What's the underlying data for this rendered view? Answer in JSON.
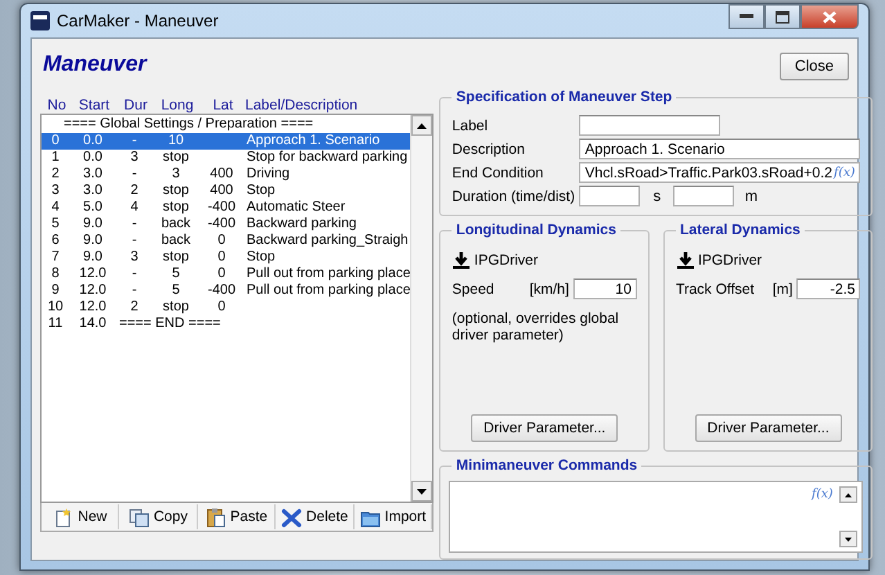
{
  "window": {
    "title": "CarMaker - Maneuver"
  },
  "heading": "Maneuver",
  "close_button": "Close",
  "list": {
    "columns": [
      "No",
      "Start",
      "Dur",
      "Long",
      "Lat",
      "Label/Description"
    ],
    "rows": [
      {
        "kind": "banner",
        "text": "==== Global Settings / Preparation ====",
        "selected": false
      },
      {
        "kind": "step",
        "no": "0",
        "start": "0.0",
        "dur": "-",
        "long": "10",
        "label": "Approach 1. Scenario",
        "selected": true
      },
      {
        "kind": "step",
        "no": "1",
        "start": "0.0",
        "dur": "3",
        "long": "stop",
        "label": "Stop for backward parking",
        "selected": false
      },
      {
        "kind": "step",
        "no": "2",
        "start": "3.0",
        "dur": "-",
        "long": "3",
        "lat": "400",
        "label": "Driving",
        "selected": false
      },
      {
        "kind": "step",
        "no": "3",
        "start": "3.0",
        "dur": "2",
        "long": "stop",
        "lat": "400",
        "label": "Stop",
        "selected": false
      },
      {
        "kind": "step",
        "no": "4",
        "start": "5.0",
        "dur": "4",
        "long": "stop",
        "lat": "-400",
        "label": "Automatic Steer",
        "selected": false
      },
      {
        "kind": "step",
        "no": "5",
        "start": "9.0",
        "dur": "-",
        "long": "back",
        "lat": "-400",
        "label": "Backward parking",
        "selected": false
      },
      {
        "kind": "step",
        "no": "6",
        "start": "9.0",
        "dur": "-",
        "long": "back",
        "lat": "0",
        "label": "Backward parking_Straigh",
        "selected": false
      },
      {
        "kind": "step",
        "no": "7",
        "start": "9.0",
        "dur": "3",
        "long": "stop",
        "lat": "0",
        "label": "Stop",
        "selected": false
      },
      {
        "kind": "step",
        "no": "8",
        "start": "12.0",
        "dur": "-",
        "long": "5",
        "lat": "0",
        "label": "Pull out from parking place",
        "selected": false
      },
      {
        "kind": "step",
        "no": "9",
        "start": "12.0",
        "dur": "-",
        "long": "5",
        "lat": "-400",
        "label": "Pull out from parking place",
        "selected": false
      },
      {
        "kind": "step",
        "no": "10",
        "start": "12.0",
        "dur": "2",
        "long": "stop",
        "lat": "0",
        "selected": false
      },
      {
        "kind": "end",
        "no": "11",
        "start": "14.0",
        "text": "==== END ====",
        "selected": false
      }
    ]
  },
  "toolbar": [
    "New",
    "Copy",
    "Paste",
    "Delete",
    "Import"
  ],
  "specification": {
    "title": "Specification of Maneuver Step",
    "label_field": {
      "label": "Label"
    },
    "description": {
      "label": "Description",
      "value": "Approach 1. Scenario"
    },
    "end_condition": {
      "label": "End Condition",
      "value": "Vhcl.sRoad>Traffic.Park03.sRoad+0.2",
      "function_button": "f(x)"
    },
    "duration": {
      "label": "Duration (time/dist)",
      "time_unit": "s",
      "dist_unit": "m"
    }
  },
  "longitudinal": {
    "title": "Longitudinal Dynamics",
    "driver": "IPGDriver",
    "field_label": "Speed",
    "unit": "[km/h]",
    "value": "10",
    "note": "(optional, overrides global driver parameter)",
    "button": "Driver Parameter..."
  },
  "lateral": {
    "title": "Lateral Dynamics",
    "driver": "IPGDriver",
    "field_label": "Track Offset",
    "unit": "[m]",
    "value": "-2.5",
    "button": "Driver Parameter..."
  },
  "minimaneuver": {
    "title": "Minimaneuver Commands",
    "function_button": "f(x)"
  }
}
